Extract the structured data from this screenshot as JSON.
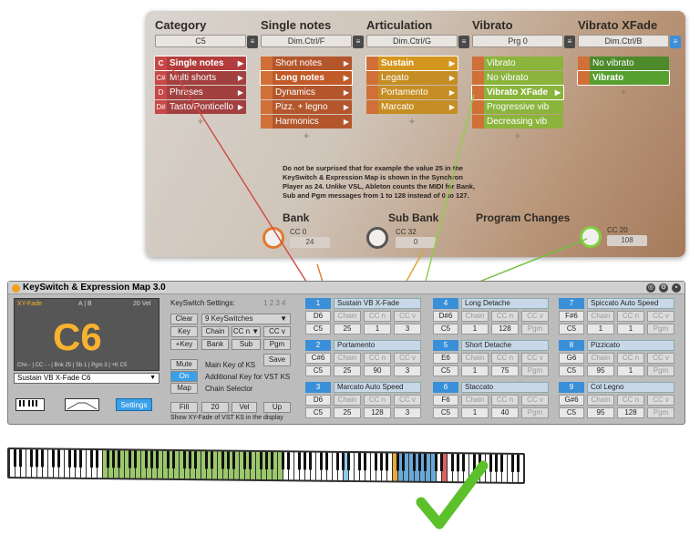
{
  "synchron": {
    "columns": [
      {
        "title": "Category",
        "selector": "C5",
        "items": [
          {
            "label": "Single notes",
            "sw": "C",
            "color": "#b23c3c",
            "sel": true,
            "arrow": true
          },
          {
            "label": "Multi shorts",
            "sw": "C#",
            "color": "#a24040",
            "sel": false,
            "arrow": true
          },
          {
            "label": "Phrases",
            "sw": "D",
            "color": "#a24040",
            "sel": false,
            "arrow": true
          },
          {
            "label": "Tasto/Ponticello",
            "sw": "D#",
            "color": "#a24040",
            "sel": false,
            "arrow": true
          }
        ]
      },
      {
        "title": "Single notes",
        "selector": "Dim.Ctrl/F",
        "items": [
          {
            "label": "Short notes",
            "color": "#b4562c",
            "sel": false,
            "arrow": true
          },
          {
            "label": "Long notes",
            "color": "#c05a28",
            "sel": true,
            "arrow": true
          },
          {
            "label": "Dynamics",
            "color": "#b4562c",
            "sel": false,
            "arrow": true
          },
          {
            "label": "Pizz. + legno",
            "color": "#b4562c",
            "sel": false,
            "arrow": true
          },
          {
            "label": "Harmonics",
            "color": "#b4562c",
            "sel": false,
            "arrow": true
          }
        ]
      },
      {
        "title": "Articulation",
        "selector": "Dim.Ctrl/G",
        "items": [
          {
            "label": "Sustain",
            "color": "#d4961e",
            "sel": true,
            "arrow": true
          },
          {
            "label": "Legato",
            "color": "#c58e24",
            "sel": false,
            "arrow": true
          },
          {
            "label": "Portamento",
            "color": "#c58e24",
            "sel": false,
            "arrow": true
          },
          {
            "label": "Marcato",
            "color": "#c58e24",
            "sel": false,
            "arrow": true
          }
        ]
      },
      {
        "title": "Vibrato",
        "selector": "Prg 0",
        "items": [
          {
            "label": "Vibrato",
            "color": "#8ab43c",
            "sel": false,
            "arrow": false
          },
          {
            "label": "No vibrato",
            "color": "#8ab43c",
            "sel": false,
            "arrow": false
          },
          {
            "label": "Vibrato XFade",
            "color": "#8ab43c",
            "sel": true,
            "arrow": true
          },
          {
            "label": "Progressive vib",
            "color": "#8ab43c",
            "sel": false,
            "arrow": false
          },
          {
            "label": "Decreasing vib",
            "color": "#8ab43c",
            "sel": false,
            "arrow": false
          }
        ]
      },
      {
        "title": "Vibrato XFade",
        "selector": "Dim.Ctrl/B",
        "items": [
          {
            "label": "No vibrato",
            "color": "#4c8a2c",
            "sel": false,
            "arrow": false
          },
          {
            "label": "Vibrato",
            "color": "#56a030",
            "sel": true,
            "arrow": false
          }
        ]
      }
    ],
    "plus": "+",
    "note": "Do not be surprised that for example the value 25 in the KeySwitch & Expression Map is shown in the Synchron Player as 24. Unlike VSL, Ableton counts the MIDI for Bank, Sub and Pgm messages from 1 to 128 instead of 0 to 127.",
    "knobs": [
      {
        "title": "Bank",
        "cc": "CC 0",
        "value": "24"
      },
      {
        "title": "Sub Bank",
        "cc": "CC 32",
        "value": "0"
      },
      {
        "title": "Program Changes",
        "cc": "",
        "value": ""
      },
      {
        "title": "",
        "cc": "CC 20",
        "value": "108"
      }
    ]
  },
  "ks": {
    "title": "KeySwitch & Expression Map 3.0",
    "display": {
      "xy": "XY-Fade",
      "ab": "A | B",
      "vel": "20  Vel",
      "note": "C6",
      "status": "Chn - | CC - - | Bnk 25 | Sb 1 | Pgm 3 | +K C5"
    },
    "preset": "Sustain VB X-Fade C6",
    "settings_label": "Settings",
    "panel": {
      "heading": "KeySwitch Settings:",
      "pages": "1 2 3 4",
      "clear": "Clear",
      "count": "9 KeySwitches",
      "key": "Key",
      "chain": "Chain",
      "ccn": "CC n ▼",
      "ccv": "CC v",
      "pkey": "+Key",
      "bank": "Bank",
      "sub": "Sub",
      "pgm": "Pgm",
      "save": "Save",
      "mute": "Mute",
      "main_key": "Main Key of KS",
      "on": "On",
      "add_key": "Additional Key for VST KS",
      "map": "Map",
      "chain_sel": "Chain Selector",
      "fill": "Fill",
      "fill_val": "20",
      "vel": "Vel",
      "up": "Up",
      "footer": "Show XY-Fade of VST KS in the display"
    },
    "slots": [
      {
        "n": "1",
        "name": "Sustain VB X-Fade",
        "key": "D6",
        "chain": "Chain",
        "ccn": "CC n",
        "ccv": "CC v",
        "k2": "C5",
        "bank": "25",
        "sub": "1",
        "pgm": "3"
      },
      {
        "n": "2",
        "name": "Portamento",
        "key": "C#6",
        "chain": "Chain",
        "ccn": "CC n",
        "ccv": "CC v",
        "k2": "C5",
        "bank": "25",
        "sub": "90",
        "pgm": "3"
      },
      {
        "n": "3",
        "name": "Marcato Auto Speed",
        "key": "D6",
        "chain": "Chain",
        "ccn": "CC n",
        "ccv": "CC v",
        "k2": "C5",
        "bank": "25",
        "sub": "128",
        "pgm": "3"
      },
      {
        "n": "4",
        "name": "Long Detache",
        "key": "D#6",
        "chain": "Chain",
        "ccn": "CC n",
        "ccv": "CC v",
        "k2": "C5",
        "bank": "1",
        "sub": "128",
        "pgm": "Pgm"
      },
      {
        "n": "5",
        "name": "Short Detache",
        "key": "E6",
        "chain": "Chain",
        "ccn": "CC n",
        "ccv": "CC v",
        "k2": "C5",
        "bank": "1",
        "sub": "75",
        "pgm": "Pgm"
      },
      {
        "n": "6",
        "name": "Staccato",
        "key": "F6",
        "chain": "Chain",
        "ccn": "CC n",
        "ccv": "CC v",
        "k2": "C5",
        "bank": "1",
        "sub": "40",
        "pgm": "Pgm"
      },
      {
        "n": "7",
        "name": "Spiccato Auto Speed",
        "key": "F#6",
        "chain": "Chain",
        "ccn": "CC n",
        "ccv": "CC v",
        "k2": "C5",
        "bank": "1",
        "sub": "1",
        "pgm": "Pgm"
      },
      {
        "n": "8",
        "name": "Pizzicato",
        "key": "G6",
        "chain": "Chain",
        "ccn": "CC n",
        "ccv": "CC v",
        "k2": "C5",
        "bank": "95",
        "sub": "1",
        "pgm": "Pgm"
      },
      {
        "n": "9",
        "name": "Col Legno",
        "key": "G#6",
        "chain": "Chain",
        "ccn": "CC n",
        "ccv": "CC v",
        "k2": "C5",
        "bank": "95",
        "sub": "128",
        "pgm": "Pgm"
      }
    ]
  }
}
